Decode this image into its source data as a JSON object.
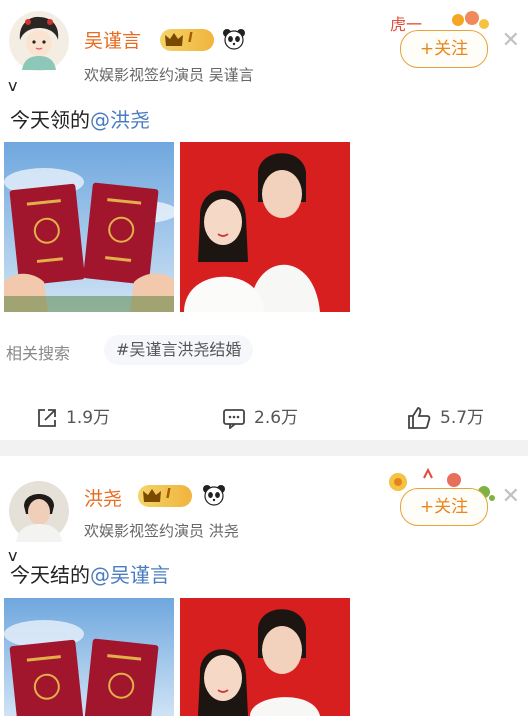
{
  "posts": [
    {
      "author": "吴谨言",
      "vip_level": "I",
      "subtitle": "欢娱影视签约演员 吴谨言",
      "follow_label": "+关注",
      "text_prefix": "今天领的",
      "mention": "@洪尧",
      "related_label": "相关搜索",
      "related_tag": "#吴谨言洪尧结婚",
      "actions": {
        "share": "1.9万",
        "comment": "2.6万",
        "like": "5.7万"
      }
    },
    {
      "author": "洪尧",
      "vip_level": "I",
      "subtitle": "欢娱影视签约演员 洪尧",
      "follow_label": "+关注",
      "text_prefix": "今天结的",
      "mention": "@吴谨言"
    }
  ],
  "colors": {
    "name": "#e86c1f",
    "mention": "#4a7cc0",
    "follow_border": "#e8a23a",
    "certificate": "#a1152d",
    "photo_bg": "#d81f1f"
  },
  "icons": [
    "close-icon",
    "share-icon",
    "comment-icon",
    "like-icon",
    "panda-icon",
    "crown-icon",
    "verified-badge-icon"
  ]
}
